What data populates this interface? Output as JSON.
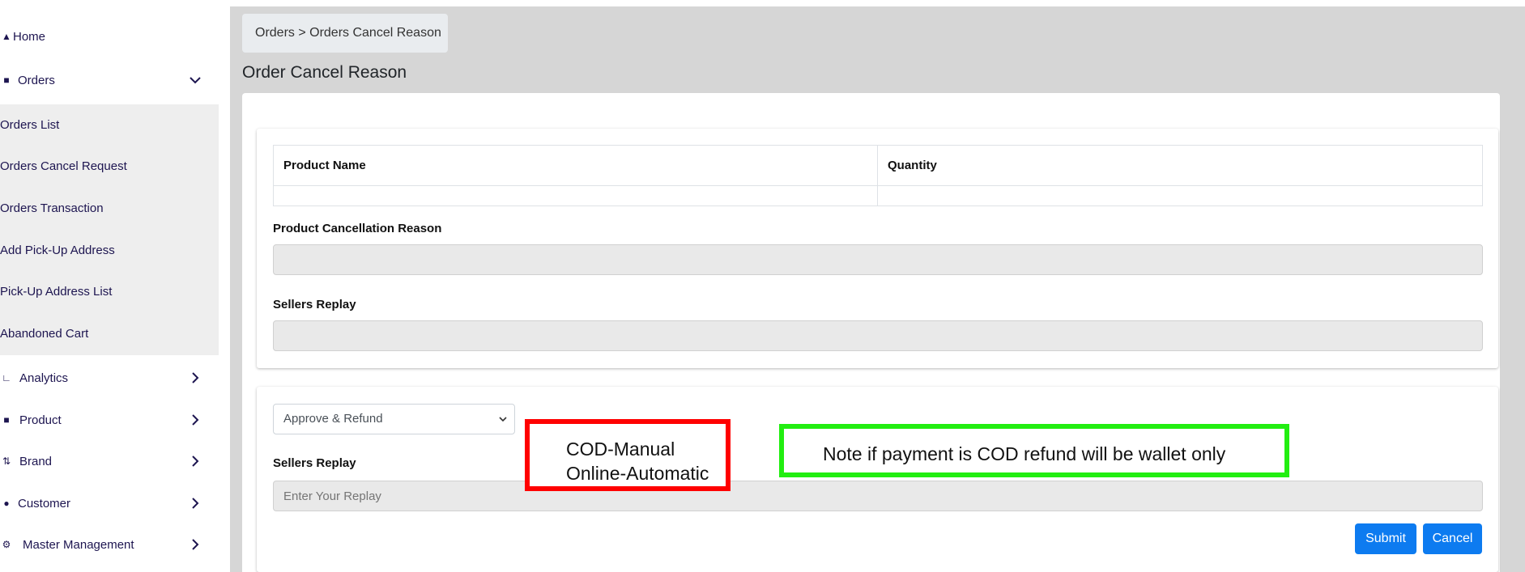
{
  "sidebar": {
    "home": "Home",
    "orders": "Orders",
    "orders_submenu": [
      "Orders List",
      "Orders Cancel Request",
      "Orders Transaction",
      "Add Pick-Up Address",
      "Pick-Up Address List",
      "Abandoned Cart"
    ],
    "analytics": "Analytics",
    "product": "Product",
    "brand": "Brand",
    "customer": "Customer",
    "master_management": "Master Management"
  },
  "breadcrumb": {
    "text": "Orders > Orders Cancel Reason"
  },
  "page_title": "Order Cancel Reason",
  "product_table": {
    "headers": [
      "Product Name",
      "Quantity"
    ],
    "rows": [
      [
        "",
        ""
      ]
    ]
  },
  "product_cancellation_reason": {
    "label": "Product Cancellation Reason",
    "value": ""
  },
  "sellers_replay_readonly": {
    "label": "Sellers Replay",
    "value": ""
  },
  "action_form": {
    "selected_action": "Approve & Refund",
    "sellers_replay_label": "Sellers Replay",
    "reply_placeholder": "Enter Your Replay",
    "submit_label": "Submit",
    "cancel_label": "Cancel"
  },
  "annotations": {
    "red_line1": "COD-Manual",
    "red_line2": "Online-Automatic",
    "green_note": "Note if payment is COD refund will be wallet only"
  },
  "colors": {
    "sidebar_text": "#1d1550",
    "accent_button": "#0d7bf0",
    "annotation_red": "#ff0000",
    "annotation_green": "#22ee11",
    "main_bg": "#d6d6d6"
  }
}
